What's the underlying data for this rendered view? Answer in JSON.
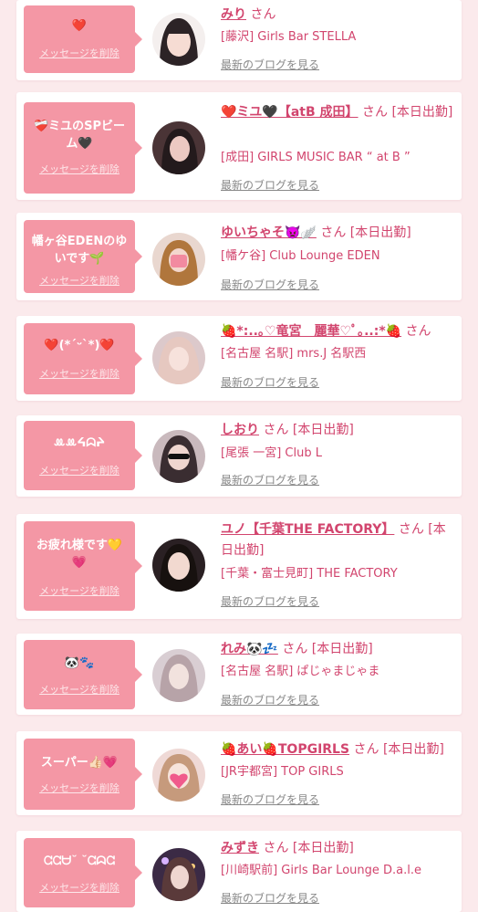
{
  "delete_label": "メッセージを削除",
  "blog_label": "最新のブログを見る",
  "san_label": "さん",
  "accent": "#f497a5",
  "text_color": "#d2456e",
  "items": [
    {
      "message": "❤️",
      "name": "みり",
      "status": "",
      "shop": "[藤沢] Girls Bar STELLA"
    },
    {
      "message": "❤️‍🩹ミユのSPビーム🖤",
      "name": "❤️ミユ🖤【atB 成田】",
      "status": "[本日出勤]",
      "shop": "[成田] GIRLS MUSIC BAR “ at B ”"
    },
    {
      "message": "幡ヶ谷EDENのゆいです🌱",
      "name": "ゆいちゃそ👿🪽",
      "status": "[本日出勤]",
      "shop": "[幡ケ谷] Club Lounge EDEN"
    },
    {
      "message": "❤️(*ˊᵕˋ*)❤️",
      "name": "🍓*:..｡♡竜宮　麗華♡ﾟ｡..:*🍓",
      "status": "",
      "shop": "[名古屋 名駅] mrs.J 名駅西"
    },
    {
      "message": "ꔛꔛᔦᗣᔨ",
      "name": "しおり",
      "status": "[本日出勤]",
      "shop": "[尾張 一宮] Club L"
    },
    {
      "message": "お疲れ様です💛💗",
      "name": "ユノ【千葉THE FACTORY】",
      "status": "[本日出勤]",
      "shop": "[千葉・富士見町] THE FACTORY"
    },
    {
      "message": "🐼🐾",
      "name": "れみ🐼💤",
      "status": "[本日出勤]",
      "shop": "[名古屋 名駅] ぱじゃまじゃま"
    },
    {
      "message": "スーパー👍🏻💗",
      "name": "🍓あい🍓TOPGIRLS",
      "status": "[本日出勤]",
      "shop": "[JR宇都宮] TOP GIRLS"
    },
    {
      "message": "ᘳᘳᗨ˘ ˘ᘳᗣᘳ",
      "name": "みずき",
      "status": "[本日出勤]",
      "shop": "[川崎駅前] Girls Bar Lounge D.a.l.e"
    }
  ]
}
